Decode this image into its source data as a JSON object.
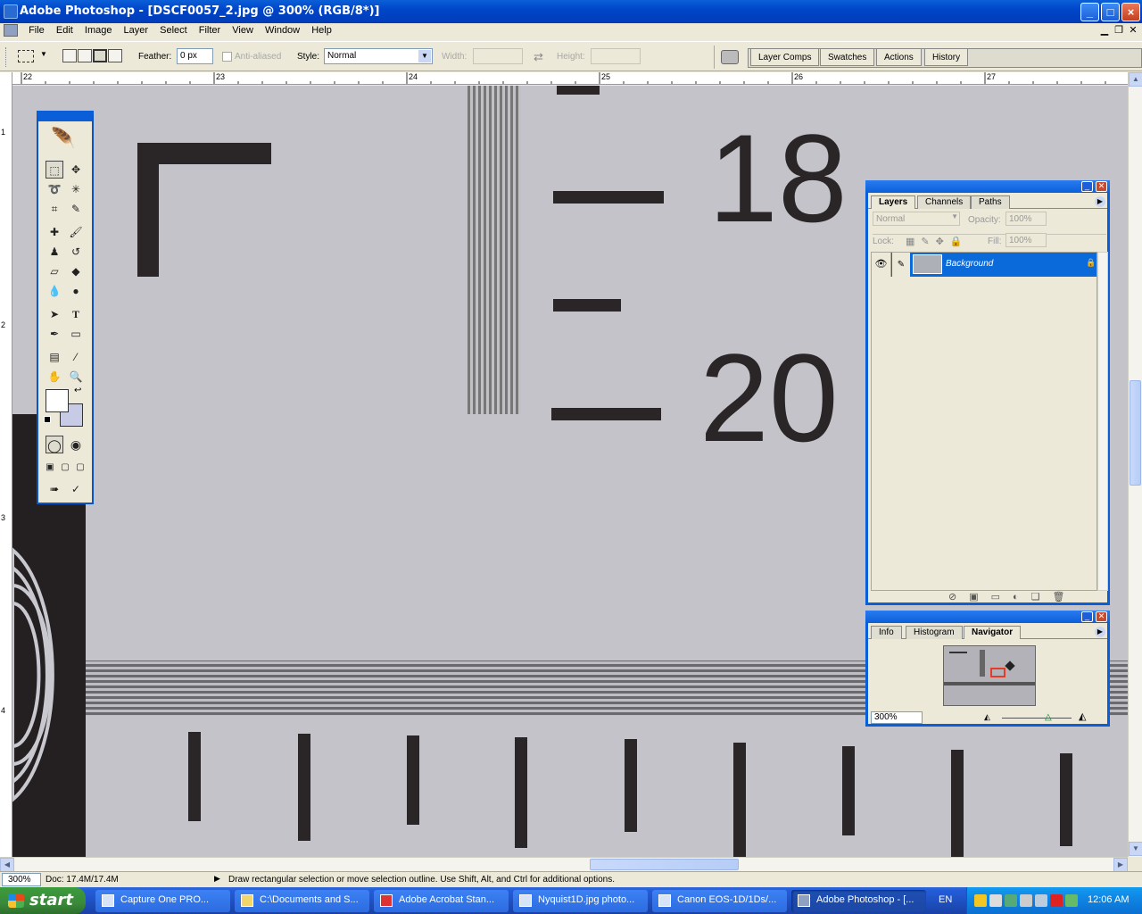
{
  "window": {
    "title": "Adobe Photoshop - [DSCF0057_2.jpg @ 300% (RGB/8*)]",
    "buttons": [
      "_",
      "□",
      "×"
    ]
  },
  "menu": [
    "File",
    "Edit",
    "Image",
    "Layer",
    "Select",
    "Filter",
    "View",
    "Window",
    "Help"
  ],
  "options": {
    "feather_label": "Feather:",
    "feather_value": "0 px",
    "antialiased_label": "Anti-aliased",
    "style_label": "Style:",
    "style_value": "Normal",
    "width_label": "Width:",
    "height_label": "Height:"
  },
  "palette_well": [
    "Layer Comps",
    "Swatches",
    "Actions",
    "History"
  ],
  "rulers": {
    "horizontal": [
      "22",
      "23",
      "24",
      "25",
      "26",
      "27"
    ],
    "vertical": [
      "1",
      "2",
      "3",
      "4"
    ]
  },
  "canvas": {
    "numbers": [
      "18",
      "20"
    ]
  },
  "layers_palette": {
    "tabs": [
      "Layers",
      "Channels",
      "Paths"
    ],
    "blend_mode": "Normal",
    "opacity_label": "Opacity:",
    "opacity_value": "100%",
    "lock_label": "Lock:",
    "fill_label": "Fill:",
    "fill_value": "100%",
    "layer_name": "Background"
  },
  "navigator_palette": {
    "tabs": [
      "Info",
      "Histogram",
      "Navigator"
    ],
    "zoom": "300%"
  },
  "statusbar": {
    "zoom": "300%",
    "doc": "Doc: 17.4M/17.4M",
    "hint": "Draw rectangular selection or move selection outline.  Use Shift, Alt, and Ctrl for additional options."
  },
  "taskbar": {
    "start": "start",
    "tasks": [
      "Capture One PRO...",
      "C:\\Documents and S...",
      "Adobe Acrobat Stan...",
      "Nyquist1D.jpg photo...",
      "Canon EOS-1D/1Ds/...",
      "Adobe Photoshop - [..."
    ],
    "language": "EN",
    "clock": "12:06 AM"
  },
  "colors": {
    "xp_blue": "#0a5fd8",
    "canvas_gray": "#c3c3c9",
    "layer_selected": "#0a6ad9",
    "navigator_box": "#e53b2b"
  }
}
